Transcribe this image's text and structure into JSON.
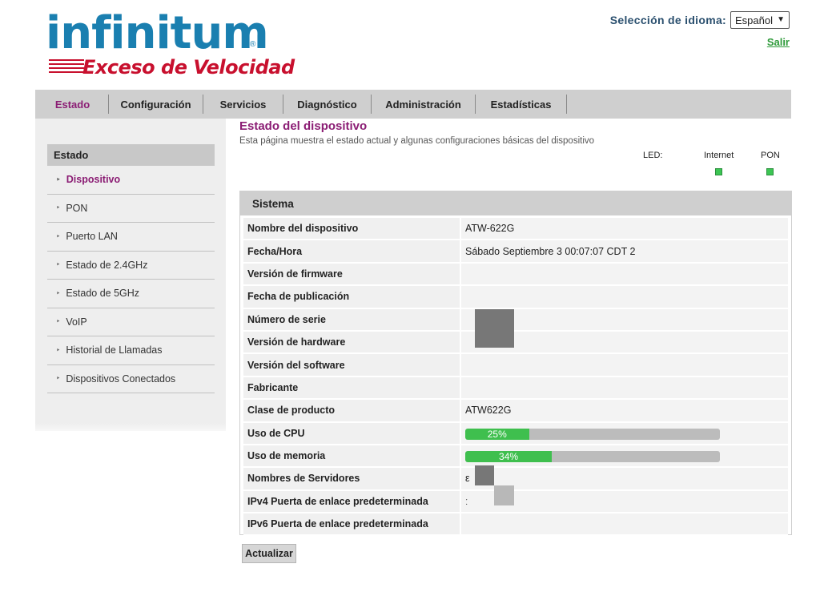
{
  "brand": {
    "name": "infinitum",
    "registered_mark": "®",
    "tagline": "Exceso de Velocidad",
    "colors": {
      "primary": "#1a7fb0",
      "secondary": "#c8102e",
      "accent": "#8b1d74",
      "ok": "#3cc553"
    }
  },
  "header": {
    "language_label": "Selección de idioma:",
    "language_value": "Español",
    "logout": "Salir"
  },
  "topnav": [
    {
      "label": "Estado",
      "active": true
    },
    {
      "label": "Configuración",
      "active": false
    },
    {
      "label": "Servicios",
      "active": false
    },
    {
      "label": "Diagnóstico",
      "active": false
    },
    {
      "label": "Administración",
      "active": false
    },
    {
      "label": "Estadísticas",
      "active": false
    }
  ],
  "sidebar": {
    "title": "Estado",
    "items": [
      {
        "label": "Dispositivo",
        "active": true
      },
      {
        "label": "PON",
        "active": false
      },
      {
        "label": "Puerto LAN",
        "active": false
      },
      {
        "label": "Estado de 2.4GHz",
        "active": false
      },
      {
        "label": "Estado de 5GHz",
        "active": false
      },
      {
        "label": "VoIP",
        "active": false
      },
      {
        "label": "Historial de Llamadas",
        "active": false
      },
      {
        "label": "Dispositivos Conectados",
        "active": false
      }
    ]
  },
  "main": {
    "title": "Estado del dispositivo",
    "description": "Esta página muestra el estado actual y algunas configuraciones básicas del dispositivo",
    "led": {
      "label": "LED:",
      "internet": "Internet",
      "pon": "PON"
    },
    "panel_title": "Sistema",
    "rows": [
      {
        "key": "Nombre del dispositivo",
        "value": "ATW-622G"
      },
      {
        "key": "Fecha/Hora",
        "value": "Sábado Septiembre 3 00:07:07 CDT 2"
      },
      {
        "key": "Versión de firmware",
        "value": ""
      },
      {
        "key": "Fecha de publicación",
        "value": ""
      },
      {
        "key": "Número de serie",
        "value": ""
      },
      {
        "key": "Versión de hardware",
        "value": ""
      },
      {
        "key": "Versión del software",
        "value": ""
      },
      {
        "key": "Fabricante",
        "value": ""
      },
      {
        "key": "Clase de producto",
        "value": "ATW622G"
      },
      {
        "key": "Uso de CPU",
        "value": "25%",
        "percent": 25
      },
      {
        "key": "Uso de memoria",
        "value": "34%",
        "percent": 34
      },
      {
        "key": "Nombres de Servidores",
        "value": "ε"
      },
      {
        "key": "IPv4 Puerta de enlace predeterminada",
        "value": "ː"
      },
      {
        "key": "IPv6 Puerta de enlace predeterminada",
        "value": ""
      }
    ],
    "refresh_button": "Actualizar"
  }
}
